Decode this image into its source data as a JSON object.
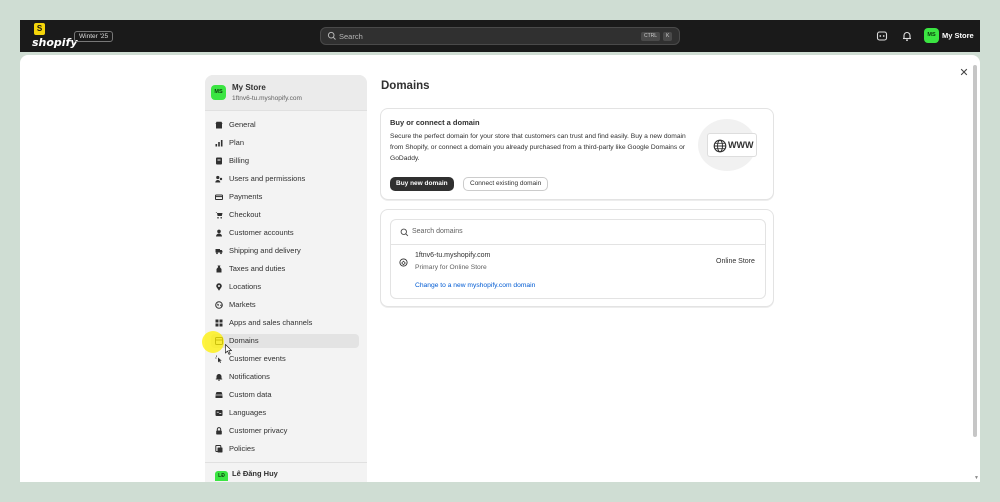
{
  "topbar": {
    "logo_bag": "S",
    "logo_text": "shopify",
    "badge": "Winter '25",
    "search_placeholder": "Search",
    "kbd1": "CTRL",
    "kbd2": "K",
    "avatar": "MS",
    "store": "My Store"
  },
  "sidebar": {
    "avatar": "MS",
    "store_name": "My Store",
    "store_url": "1ftnv6-tu.myshopify.com",
    "items": [
      {
        "label": "General",
        "icon": "store-icon"
      },
      {
        "label": "Plan",
        "icon": "plan-icon"
      },
      {
        "label": "Billing",
        "icon": "billing-icon"
      },
      {
        "label": "Users and permissions",
        "icon": "users-icon"
      },
      {
        "label": "Payments",
        "icon": "payments-icon"
      },
      {
        "label": "Checkout",
        "icon": "cart-icon"
      },
      {
        "label": "Customer accounts",
        "icon": "person-icon"
      },
      {
        "label": "Shipping and delivery",
        "icon": "truck-icon"
      },
      {
        "label": "Taxes and duties",
        "icon": "taxes-icon"
      },
      {
        "label": "Locations",
        "icon": "location-icon"
      },
      {
        "label": "Markets",
        "icon": "globe-icon"
      },
      {
        "label": "Apps and sales channels",
        "icon": "apps-icon"
      },
      {
        "label": "Domains",
        "icon": "domains-icon"
      },
      {
        "label": "Customer events",
        "icon": "cursor-click-icon"
      },
      {
        "label": "Notifications",
        "icon": "bell-icon"
      },
      {
        "label": "Custom data",
        "icon": "database-icon"
      },
      {
        "label": "Languages",
        "icon": "languages-icon"
      },
      {
        "label": "Customer privacy",
        "icon": "lock-icon"
      },
      {
        "label": "Policies",
        "icon": "policies-icon"
      }
    ],
    "active_index": 12,
    "user_initials": "LĐ",
    "user_name": "Lê Đăng Huy"
  },
  "main": {
    "title": "Domains",
    "buy_card": {
      "title": "Buy or connect a domain",
      "description": "Secure the perfect domain for your store that customers can trust and find easily. Buy a new domain from Shopify, or connect a domain you already purchased from a third-party like Google Domains or GoDaddy.",
      "primary_button": "Buy new domain",
      "secondary_button": "Connect existing domain",
      "illustration_text": "WWW"
    },
    "domains_card": {
      "search_placeholder": "Search domains",
      "domain": "1ftnv6-tu.myshopify.com",
      "domain_sub": "Primary for Online Store",
      "channel": "Online Store",
      "change_link": "Change to a new myshopify.com domain"
    }
  },
  "colors": {
    "topbar": "#1a1a1a",
    "avatar_green": "#3be542",
    "link_blue": "#005bd3",
    "background": "#cfddd3"
  }
}
